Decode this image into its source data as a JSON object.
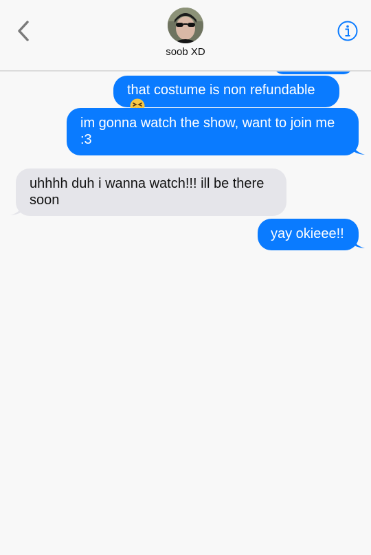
{
  "header": {
    "contact_name": "soob XD",
    "back_icon": "chevron-left-icon",
    "info_icon": "info-icon",
    "accent_color": "#0a7bff"
  },
  "messages": [
    {
      "direction": "outgoing",
      "text": "that costume is non refundable",
      "emoji": "confounded-face-icon"
    },
    {
      "direction": "outgoing",
      "text": "im gonna watch the show, want to join me :3"
    },
    {
      "direction": "incoming",
      "text": "uhhhh duh i wanna watch!!! ill be there soon"
    },
    {
      "direction": "outgoing",
      "text": "yay okieee!!"
    }
  ],
  "colors": {
    "outgoing_bubble": "#0a7bff",
    "incoming_bubble": "#e5e5ea",
    "background": "#f8f8f8"
  }
}
